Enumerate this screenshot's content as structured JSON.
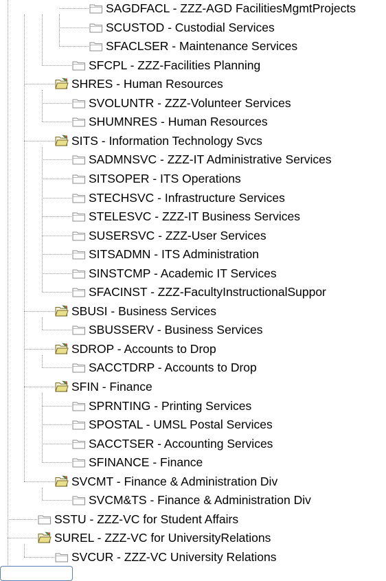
{
  "tree": {
    "nodes": [
      {
        "label": "SAGDFACL - ZZZ-AGD FacilitiesMgmtProjects",
        "level": 4,
        "open": false
      },
      {
        "label": "SCUSTOD - Custodial Services",
        "level": 4,
        "open": false
      },
      {
        "label": "SFACLSER - Maintenance Services",
        "level": 4,
        "open": false
      },
      {
        "label": "SFCPL - ZZZ-Facilities Planning",
        "level": 3,
        "open": false
      },
      {
        "label": "SHRES - Human Resources",
        "level": 2,
        "open": true
      },
      {
        "label": "SVOLUNTR - ZZZ-Volunteer Services",
        "level": 3,
        "open": false
      },
      {
        "label": "SHUMNRES - Human Resources",
        "level": 3,
        "open": false
      },
      {
        "label": "SITS - Information Technology Svcs",
        "level": 2,
        "open": true
      },
      {
        "label": "SADMNSVC - ZZZ-IT Administrative Services",
        "level": 3,
        "open": false
      },
      {
        "label": "SITSOPER - ITS Operations",
        "level": 3,
        "open": false
      },
      {
        "label": "STECHSVC - Infrastructure Services",
        "level": 3,
        "open": false
      },
      {
        "label": "STELESVC - ZZZ-IT Business Services",
        "level": 3,
        "open": false
      },
      {
        "label": "SUSERSVC - ZZZ-User Services",
        "level": 3,
        "open": false
      },
      {
        "label": "SITSADMN - ITS Administration",
        "level": 3,
        "open": false
      },
      {
        "label": "SINSTCMP - Academic IT Services",
        "level": 3,
        "open": false
      },
      {
        "label": "SFACINST - ZZZ-FacultyInstructionalSuppor",
        "level": 3,
        "open": false
      },
      {
        "label": "SBUSI - Business Services",
        "level": 2,
        "open": true
      },
      {
        "label": "SBUSSERV - Business Services",
        "level": 3,
        "open": false
      },
      {
        "label": "SDROP - Accounts to Drop",
        "level": 2,
        "open": true
      },
      {
        "label": "SACCTDRP - Accounts to Drop",
        "level": 3,
        "open": false
      },
      {
        "label": "SFIN - Finance",
        "level": 2,
        "open": true
      },
      {
        "label": "SPRNTING - Printing Services",
        "level": 3,
        "open": false
      },
      {
        "label": "SPOSTAL - UMSL Postal Services",
        "level": 3,
        "open": false
      },
      {
        "label": "SACCTSER - Accounting Services",
        "level": 3,
        "open": false
      },
      {
        "label": "SFINANCE - Finance",
        "level": 3,
        "open": false
      },
      {
        "label": "SVCMT - Finance & Administration Div",
        "level": 2,
        "open": true
      },
      {
        "label": "SVCM&TS - Finance & Administration Div",
        "level": 3,
        "open": false
      },
      {
        "label": "SSTU - ZZZ-VC for Student Affairs",
        "level": 1,
        "open": false
      },
      {
        "label": "SUREL - ZZZ-VC for UniversityRelations",
        "level": 1,
        "open": true
      },
      {
        "label": "SVCUR - ZZZ-VC University Relations",
        "level": 2,
        "open": false
      }
    ]
  }
}
